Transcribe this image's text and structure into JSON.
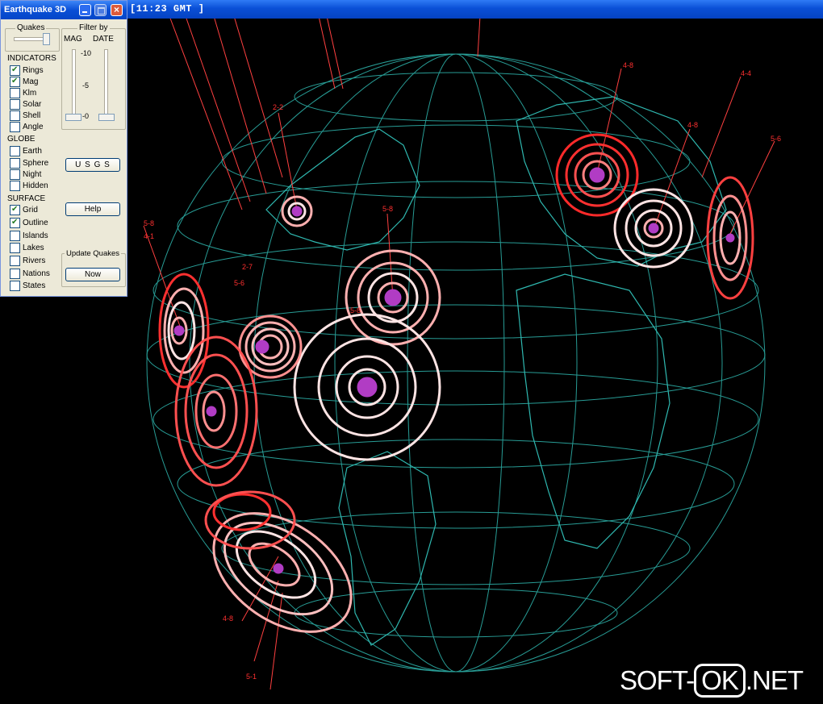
{
  "window": {
    "gmt_label": "[11:23 GMT ]"
  },
  "panel": {
    "title": "Earthquake 3D",
    "quakes_label": "Quakes",
    "filter_label": "Filter by",
    "mag_label": "MAG",
    "date_label": "DATE",
    "mag_scale": [
      "-10",
      "-5",
      "-0"
    ],
    "indicators_label": "INDICATORS",
    "indicators": [
      {
        "label": "Rings",
        "checked": true
      },
      {
        "label": "Mag",
        "checked": true
      },
      {
        "label": "Klm",
        "checked": false
      },
      {
        "label": "Solar",
        "checked": false
      },
      {
        "label": "Shell",
        "checked": false
      },
      {
        "label": "Angle",
        "checked": false
      }
    ],
    "globe_label": "GLOBE",
    "globe": [
      {
        "label": "Earth",
        "checked": false
      },
      {
        "label": "Sphere",
        "checked": false
      },
      {
        "label": "Night",
        "checked": false
      },
      {
        "label": "Hidden",
        "checked": false
      }
    ],
    "surface_label": "SURFACE",
    "surface": [
      {
        "label": "Grid",
        "checked": true
      },
      {
        "label": "Outline",
        "checked": true
      },
      {
        "label": "Islands",
        "checked": false
      },
      {
        "label": "Lakes",
        "checked": false
      },
      {
        "label": "Rivers",
        "checked": false
      },
      {
        "label": "Nations",
        "checked": false
      },
      {
        "label": "States",
        "checked": false
      }
    ],
    "usgs_button": "U S G S",
    "help_button": "Help",
    "update_label": "Update Quakes",
    "now_button": "Now"
  },
  "quake_labels": [
    "2-2",
    "5-8",
    "5-8",
    "2-7",
    "5-6",
    "4-8",
    "4-4",
    "4-8",
    "5-6",
    "5-8",
    "4-1",
    "4-8",
    "5-1"
  ],
  "watermark": {
    "prefix": "SOFT-",
    "ok": "OK",
    "suffix": ".NET"
  },
  "colors": {
    "grid": "#2fb8b0",
    "ring_red": "#ff2a2a",
    "ring_pink": "#ffb0b0",
    "ring_white": "#ffe4e4",
    "core": "#b13cc4"
  }
}
